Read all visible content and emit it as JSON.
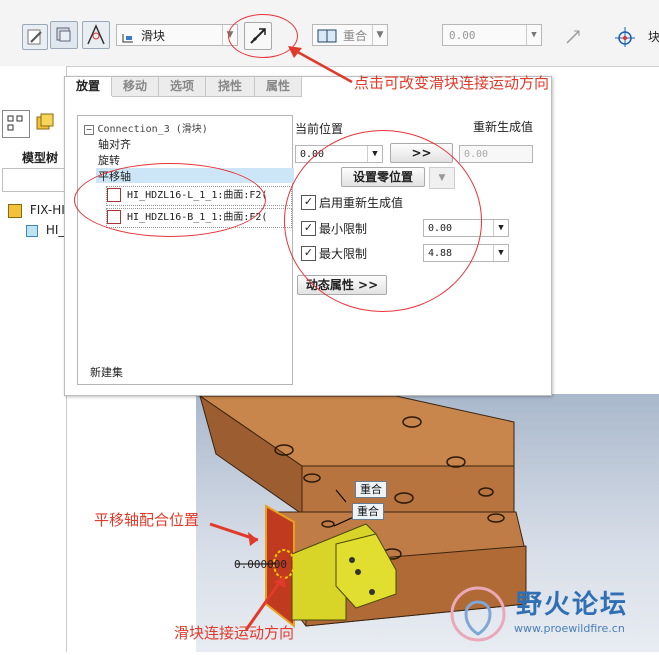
{
  "toolbar": {
    "type_value": "滑块",
    "constraint_value": "重合",
    "offset_value": "0.00",
    "right_label": "块"
  },
  "left_panel": {
    "model_tree_label": "模型树",
    "tree_items": [
      "FIX-HI",
      "HI_"
    ]
  },
  "dashboard": {
    "tabs": [
      "放置",
      "移动",
      "选项",
      "挠性",
      "属性"
    ],
    "connection_title": "Connection_3 (滑块)",
    "sets": [
      "轴对齐",
      "旋转",
      "平移轴"
    ],
    "references": [
      "HI_HDZL16-L_1_1:曲面:F2(",
      "HI_HDZL16-B_1_1:曲面:F2("
    ],
    "new_set": "新建集",
    "current_position_label": "当前位置",
    "current_position_value": "0.00",
    "regenerate_value_label": "重新生成值",
    "regenerate_value": "0.00",
    "arrow_button": ">>",
    "set_zero_button": "设置零位置",
    "enable_regen_label": "启用重新生成值",
    "min_limit_label": "最小限制",
    "min_limit_value": "0.00",
    "max_limit_label": "最大限制",
    "max_limit_value": "4.88",
    "dynamic_props_button": "动态属性 >>"
  },
  "annotations": {
    "top": "点击可改变滑块连接运动方向",
    "left": "平移轴配合位置",
    "bottom": "滑块连接运动方向"
  },
  "viewport": {
    "tag1": "重合",
    "tag2": "重合",
    "dimension": "0.000000"
  },
  "watermark": {
    "title": "野火论坛",
    "url": "www.proewildfire.cn"
  },
  "colors": {
    "annotation_red": "#e03a2a",
    "model_orange": "#c8864c",
    "slider_yellow": "#d8d428",
    "selection_blue": "#cde6f7"
  }
}
